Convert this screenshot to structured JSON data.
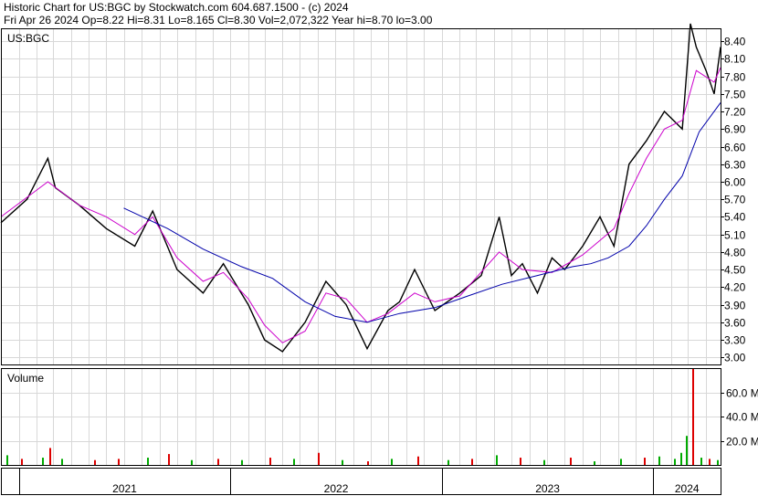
{
  "header": {
    "line1": "Historic Chart for US:BGC by Stockwatch.com 604.687.1500 - (c) 2024",
    "line2": "Fri Apr 26 2024  Op=8.22  Hi=8.31  Lo=8.165  Cl=8.30  Vol=2,072,322  Year hi=8.70  lo=3.00"
  },
  "chart_data": [
    {
      "type": "line",
      "panel": "price",
      "symbol_label": "US:BGC",
      "y_tick_labels": [
        "8.40",
        "8.10",
        "7.80",
        "7.50",
        "7.20",
        "6.90",
        "6.60",
        "6.30",
        "6.00",
        "5.70",
        "5.40",
        "5.10",
        "4.80",
        "4.50",
        "4.20",
        "3.90",
        "3.60",
        "3.30",
        "3.00"
      ],
      "ylim": [
        2.88,
        8.62
      ],
      "x_tick_labels": [
        "2021",
        "2022",
        "2023",
        "2024"
      ],
      "xlim": [
        "2020-12-01",
        "2024-04-26"
      ],
      "series": [
        {
          "name": "",
          "style": "price",
          "color": "#000000",
          "x": [
            "2020-12-01",
            "2021-01-15",
            "2021-02-20",
            "2021-03-05",
            "2021-04-15",
            "2021-06-01",
            "2021-07-20",
            "2021-08-20",
            "2021-10-01",
            "2021-11-15",
            "2021-12-20",
            "2022-02-01",
            "2022-03-01",
            "2022-04-01",
            "2022-05-10",
            "2022-06-15",
            "2022-07-20",
            "2022-08-25",
            "2022-09-30",
            "2022-10-20",
            "2022-11-15",
            "2022-12-20",
            "2023-02-01",
            "2023-03-10",
            "2023-04-10",
            "2023-05-01",
            "2023-05-20",
            "2023-06-15",
            "2023-07-10",
            "2023-08-01",
            "2023-09-01",
            "2023-10-01",
            "2023-10-25",
            "2023-11-20",
            "2023-12-20",
            "2024-01-20",
            "2024-02-20",
            "2024-03-05",
            "2024-03-15",
            "2024-04-01",
            "2024-04-15",
            "2024-04-26"
          ],
          "values": [
            5.3,
            5.7,
            6.4,
            5.9,
            5.6,
            5.2,
            4.9,
            5.5,
            4.5,
            4.1,
            4.6,
            3.9,
            3.3,
            3.1,
            3.6,
            4.3,
            3.9,
            3.15,
            3.8,
            3.95,
            4.5,
            3.8,
            4.1,
            4.4,
            5.4,
            4.4,
            4.6,
            4.1,
            4.7,
            4.5,
            4.9,
            5.4,
            4.9,
            6.3,
            6.7,
            7.2,
            6.9,
            8.7,
            8.3,
            7.9,
            7.5,
            8.3
          ]
        },
        {
          "name": "",
          "style": "short moving average",
          "color": "#cc00cc",
          "x": [
            "2020-12-01",
            "2021-02-20",
            "2021-04-15",
            "2021-06-01",
            "2021-07-20",
            "2021-08-20",
            "2021-10-01",
            "2021-11-15",
            "2021-12-20",
            "2022-02-01",
            "2022-03-01",
            "2022-04-01",
            "2022-05-10",
            "2022-06-15",
            "2022-07-20",
            "2022-08-25",
            "2022-09-30",
            "2022-11-15",
            "2022-12-20",
            "2023-02-01",
            "2023-04-10",
            "2023-05-20",
            "2023-07-10",
            "2023-09-01",
            "2023-10-25",
            "2023-11-20",
            "2023-12-20",
            "2024-01-20",
            "2024-02-20",
            "2024-03-15",
            "2024-04-15",
            "2024-04-26"
          ],
          "values": [
            5.4,
            6.0,
            5.6,
            5.4,
            5.1,
            5.4,
            4.7,
            4.3,
            4.45,
            4.0,
            3.55,
            3.25,
            3.45,
            4.1,
            4.0,
            3.6,
            3.75,
            4.1,
            3.95,
            4.05,
            4.8,
            4.5,
            4.45,
            4.75,
            5.2,
            5.8,
            6.4,
            6.9,
            7.05,
            7.9,
            7.7,
            7.95
          ]
        },
        {
          "name": "",
          "style": "long moving average",
          "color": "#0000aa",
          "x": [
            "2021-07-01",
            "2021-09-15",
            "2021-11-15",
            "2022-01-20",
            "2022-03-15",
            "2022-05-10",
            "2022-07-01",
            "2022-08-25",
            "2022-10-20",
            "2022-12-20",
            "2023-02-15",
            "2023-04-15",
            "2023-06-15",
            "2023-08-15",
            "2023-09-15",
            "2023-10-15",
            "2023-11-20",
            "2023-12-20",
            "2024-01-20",
            "2024-02-20",
            "2024-03-20",
            "2024-04-26"
          ],
          "values": [
            5.55,
            5.2,
            4.85,
            4.55,
            4.35,
            3.95,
            3.7,
            3.6,
            3.75,
            3.85,
            4.05,
            4.25,
            4.4,
            4.55,
            4.6,
            4.7,
            4.9,
            5.25,
            5.7,
            6.1,
            6.85,
            7.35
          ]
        }
      ]
    },
    {
      "type": "bar",
      "panel": "volume",
      "title": "Volume",
      "y_tick_labels": [
        "60.0 M",
        "40.0 M",
        "20.0 M"
      ],
      "ylim": [
        0,
        80
      ],
      "up_color": "#00aa00",
      "down_color": "#dd0000",
      "series": [
        {
          "name": "",
          "x": [
            "2020-12-10",
            "2021-01-05",
            "2021-02-10",
            "2021-02-22",
            "2021-03-15",
            "2021-05-10",
            "2021-06-20",
            "2021-08-10",
            "2021-09-15",
            "2021-10-25",
            "2021-12-10",
            "2022-01-20",
            "2022-03-10",
            "2022-04-20",
            "2022-06-01",
            "2022-07-12",
            "2022-08-25",
            "2022-10-05",
            "2022-11-20",
            "2023-01-10",
            "2023-02-20",
            "2023-04-05",
            "2023-05-15",
            "2023-06-25",
            "2023-08-10",
            "2023-09-20",
            "2023-11-05",
            "2023-12-15",
            "2024-01-10",
            "2024-02-05",
            "2024-02-16",
            "2024-02-26",
            "2024-03-08",
            "2024-03-22",
            "2024-04-05",
            "2024-04-20"
          ],
          "values": [
            8,
            5,
            6,
            14,
            5,
            4,
            5,
            6,
            9,
            4,
            5,
            4,
            6,
            5,
            10,
            4,
            3,
            5,
            7,
            4,
            5,
            8,
            6,
            4,
            6,
            3,
            5,
            6,
            7,
            5,
            10,
            24,
            80,
            6,
            5,
            4
          ],
          "direction": [
            "up",
            "down",
            "up",
            "down",
            "up",
            "down",
            "down",
            "up",
            "down",
            "up",
            "down",
            "up",
            "down",
            "up",
            "down",
            "up",
            "down",
            "up",
            "down",
            "up",
            "down",
            "up",
            "down",
            "up",
            "down",
            "up",
            "up",
            "down",
            "up",
            "up",
            "up",
            "up",
            "down",
            "up",
            "down",
            "up"
          ]
        }
      ]
    }
  ]
}
